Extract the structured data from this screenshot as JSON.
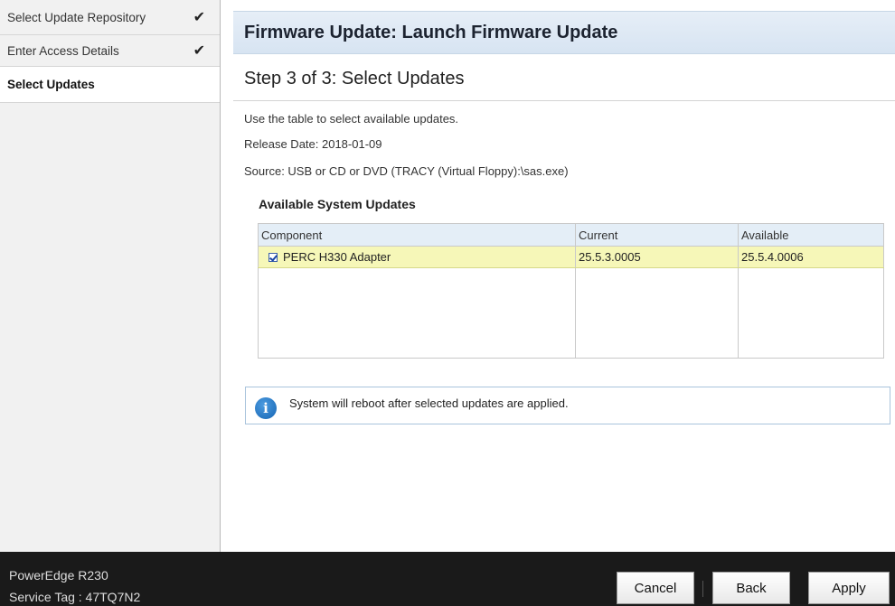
{
  "sidebar": {
    "items": [
      {
        "label": "Select Update Repository",
        "done": true
      },
      {
        "label": "Enter Access Details",
        "done": true
      },
      {
        "label": "Select Updates",
        "done": false,
        "active": true
      }
    ],
    "check_icon": "check-icon"
  },
  "header": {
    "title": "Firmware Update: Launch Firmware Update"
  },
  "step": {
    "title": "Step 3 of 3: Select Updates"
  },
  "info": {
    "instruction": "Use the table to select available updates.",
    "release_date": "Release Date: 2018-01-09",
    "source": "Source: USB or CD or DVD (TRACY (Virtual Floppy):\\sas.exe)"
  },
  "updates": {
    "title": "Available System Updates",
    "columns": [
      "Component",
      "Current",
      "Available"
    ],
    "rows": [
      {
        "checked": true,
        "component": "PERC H330 Adapter",
        "current": "25.5.3.0005",
        "available": "25.5.4.0006"
      }
    ]
  },
  "notice": {
    "icon": "info-icon",
    "text": "System will reboot after selected updates are applied."
  },
  "footer": {
    "model": "PowerEdge R230",
    "service_tag": "Service Tag : 47TQ7N2",
    "buttons": {
      "cancel": "Cancel",
      "back": "Back",
      "apply": "Apply"
    }
  },
  "colors": {
    "header_bg": "#dce7f3",
    "selected_row": "#f6f7b8",
    "footer_bg": "#1a1a1a",
    "info_blue": "#1565b3"
  }
}
